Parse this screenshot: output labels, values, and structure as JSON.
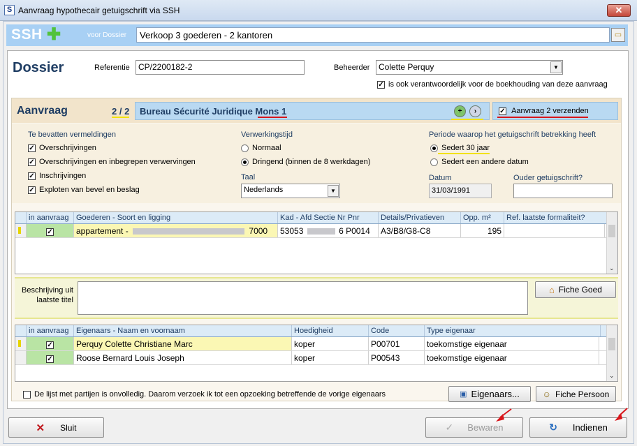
{
  "window": {
    "title": "Aanvraag hypothecair getuigschrift via SSH",
    "close_label": "✕"
  },
  "header": {
    "logo_text": "SSH",
    "voor_dossier_label": "voor Dossier",
    "dossier_value": "Verkoop  3 goederen - 2 kantoren"
  },
  "dossier": {
    "title": "Dossier",
    "referentie_label": "Referentie",
    "referentie_value": "CP/2200182-2",
    "beheerder_label": "Beheerder",
    "beheerder_value": "Colette Perquy",
    "boekhouding_label": "is ook verantwoordelijk voor de boekhouding van deze aanvraag",
    "boekhouding_checked": true
  },
  "aanvraag": {
    "title": "Aanvraag",
    "counter": "2 / 2",
    "bureau": "Bureau Sécurité Juridique Mons 1",
    "verzenden_label": "Aanvraag 2 verzenden",
    "verzenden_checked": true
  },
  "vermeldingen": {
    "title": "Te bevatten vermeldingen",
    "items": [
      {
        "label": "Overschrijvingen",
        "checked": true
      },
      {
        "label": "Overschrijvingen en inbegrepen verwervingen",
        "checked": true
      },
      {
        "label": "Inschrijvingen",
        "checked": true
      },
      {
        "label": "Exploten van bevel en beslag",
        "checked": true
      }
    ]
  },
  "verwerkingstijd": {
    "title": "Verwerkingstijd",
    "options": [
      {
        "label": "Normaal",
        "selected": false
      },
      {
        "label": "Dringend (binnen de 8 werkdagen)",
        "selected": true
      }
    ],
    "taal_label": "Taal",
    "taal_value": "Nederlands"
  },
  "periode": {
    "title": "Periode waarop het getuigschrift betrekking heeft",
    "options": [
      {
        "label": "Sedert 30 jaar",
        "selected": true
      },
      {
        "label": "Sedert een andere datum",
        "selected": false
      }
    ],
    "datum_label": "Datum",
    "datum_value": "31/03/1991",
    "ouder_label": "Ouder getuigschrift?",
    "ouder_value": ""
  },
  "goederen_table": {
    "columns": [
      "in aanvraag",
      "Goederen - Soort en ligging",
      "Kad - Afd Sectie Nr Pnr",
      "Details/Privatieven",
      "Opp. m²",
      "Ref. laatste formaliteit?"
    ],
    "rows": [
      {
        "in_aanvraag": true,
        "goed": "appartement -",
        "goed_suffix": "7000",
        "kad": "53053",
        "kad_suffix": "6 P0014",
        "details": "A3/B8/G8-C8",
        "opp": "195",
        "ref": ""
      }
    ]
  },
  "beschrijving": {
    "label_line1": "Beschrijving uit",
    "label_line2": "laatste titel",
    "value": "",
    "fiche_goed_label": "Fiche Goed"
  },
  "eigenaars_table": {
    "columns": [
      "in aanvraag",
      "Eigenaars - Naam en voornaam",
      "Hoedigheid",
      "Code",
      "Type eigenaar"
    ],
    "rows": [
      {
        "in_aanvraag": true,
        "naam": "Perquy Colette Christiane Marc",
        "hoedigheid": "koper",
        "code": "P00701",
        "type": "toekomstige eigenaar"
      },
      {
        "in_aanvraag": true,
        "naam": "Roose Bernard Louis Joseph",
        "hoedigheid": "koper",
        "code": "P00543",
        "type": "toekomstige eigenaar"
      }
    ]
  },
  "partijen": {
    "label": "De lijst met partijen is onvolledig. Daarom verzoek ik tot een opzoeking betreffende de vorige eigenaars",
    "checked": false,
    "eigenaars_btn": "Eigenaars...",
    "fiche_persoon_btn": "Fiche Persoon"
  },
  "footer": {
    "sluit": "Sluit",
    "bewaren": "Bewaren",
    "indienen": "Indienen"
  },
  "colors": {
    "accent_blue": "#1f3d63",
    "header_blue": "#a8d0f4",
    "plus_green": "#52c23c",
    "annotation_red": "#d8161b"
  }
}
